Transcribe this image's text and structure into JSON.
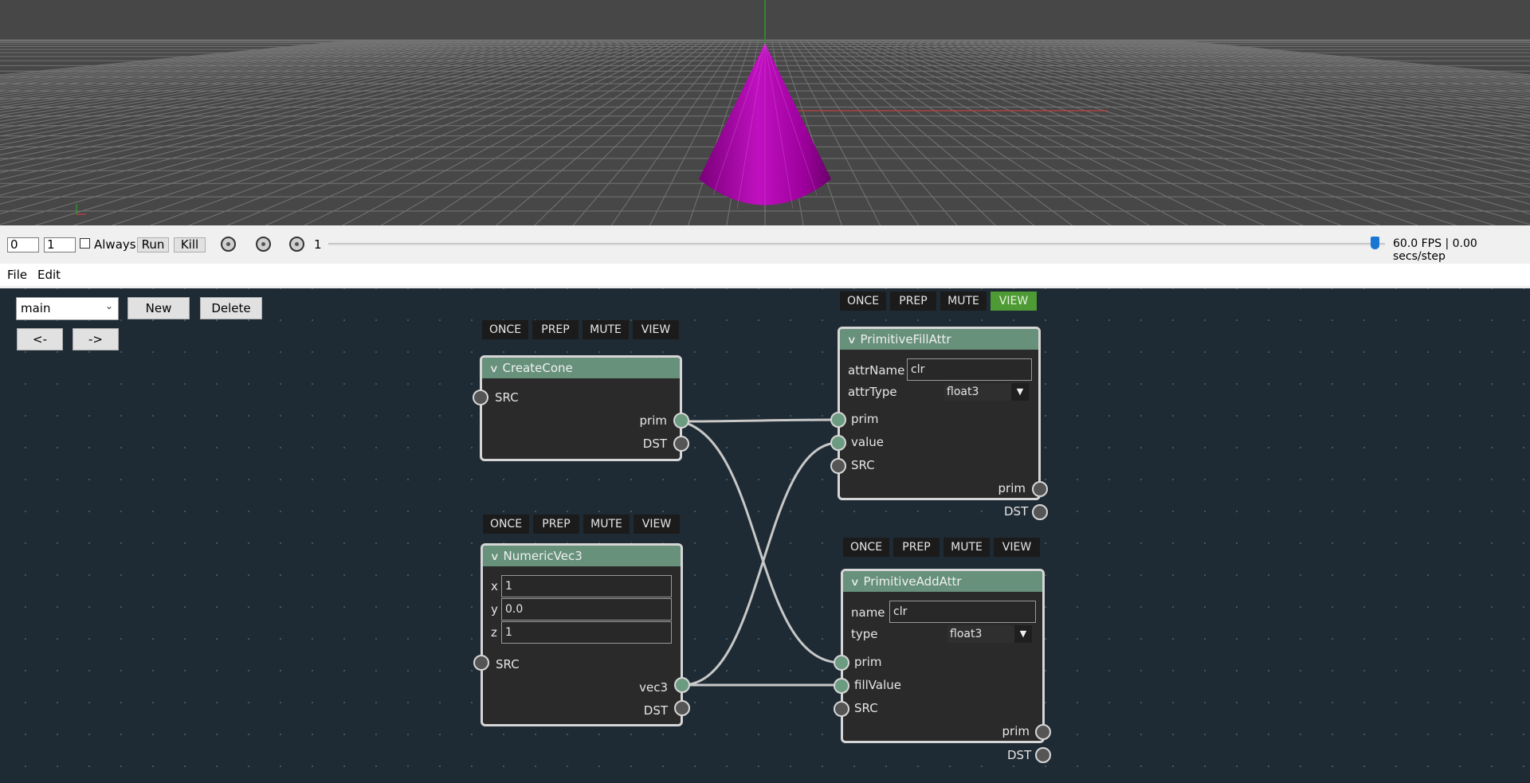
{
  "controlbar": {
    "frame_start": "0",
    "frame_end": "1",
    "always_label": "Always",
    "run_label": "Run",
    "kill_label": "Kill",
    "frame_value": "1",
    "fps_status": "60.0 FPS | 0.00 secs/step",
    "slider_position_fraction": 0.99
  },
  "menubar": {
    "file": "File",
    "edit": "Edit"
  },
  "editor": {
    "graph_select": "main",
    "new_button": "New",
    "delete_button": "Delete",
    "back_button": "<-",
    "forward_button": "->"
  },
  "toolbar_labels": {
    "once": "ONCE",
    "prep": "PREP",
    "mute": "MUTE",
    "view": "VIEW"
  },
  "nodes": {
    "create_cone": {
      "title": "CreateCone",
      "src": "SRC",
      "prim": "prim",
      "dst": "DST"
    },
    "numeric_vec3": {
      "title": "NumericVec3",
      "x_label": "x",
      "x_value": "1",
      "y_label": "y",
      "y_value": "0.0",
      "z_label": "z",
      "z_value": "1",
      "src": "SRC",
      "vec3": "vec3",
      "dst": "DST"
    },
    "primitive_fill_attr": {
      "title": "PrimitiveFillAttr",
      "attr_name_label": "attrName",
      "attr_name_value": "clr",
      "attr_type_label": "attrType",
      "attr_type_value": "float3",
      "in_prim": "prim",
      "in_value": "value",
      "src": "SRC",
      "out_prim": "prim",
      "dst": "DST",
      "view_active": true
    },
    "primitive_add_attr": {
      "title": "PrimitiveAddAttr",
      "name_label": "name",
      "name_value": "clr",
      "type_label": "type",
      "type_value": "float3",
      "in_prim": "prim",
      "in_fill_value": "fillValue",
      "src": "SRC",
      "out_prim": "prim",
      "dst": "DST"
    }
  },
  "colors": {
    "viewport_bg": "#474747",
    "cone": "#b000b0",
    "editor_bg": "#1f2b34",
    "node_header": "#67917b",
    "view_active": "#4e9a35"
  }
}
